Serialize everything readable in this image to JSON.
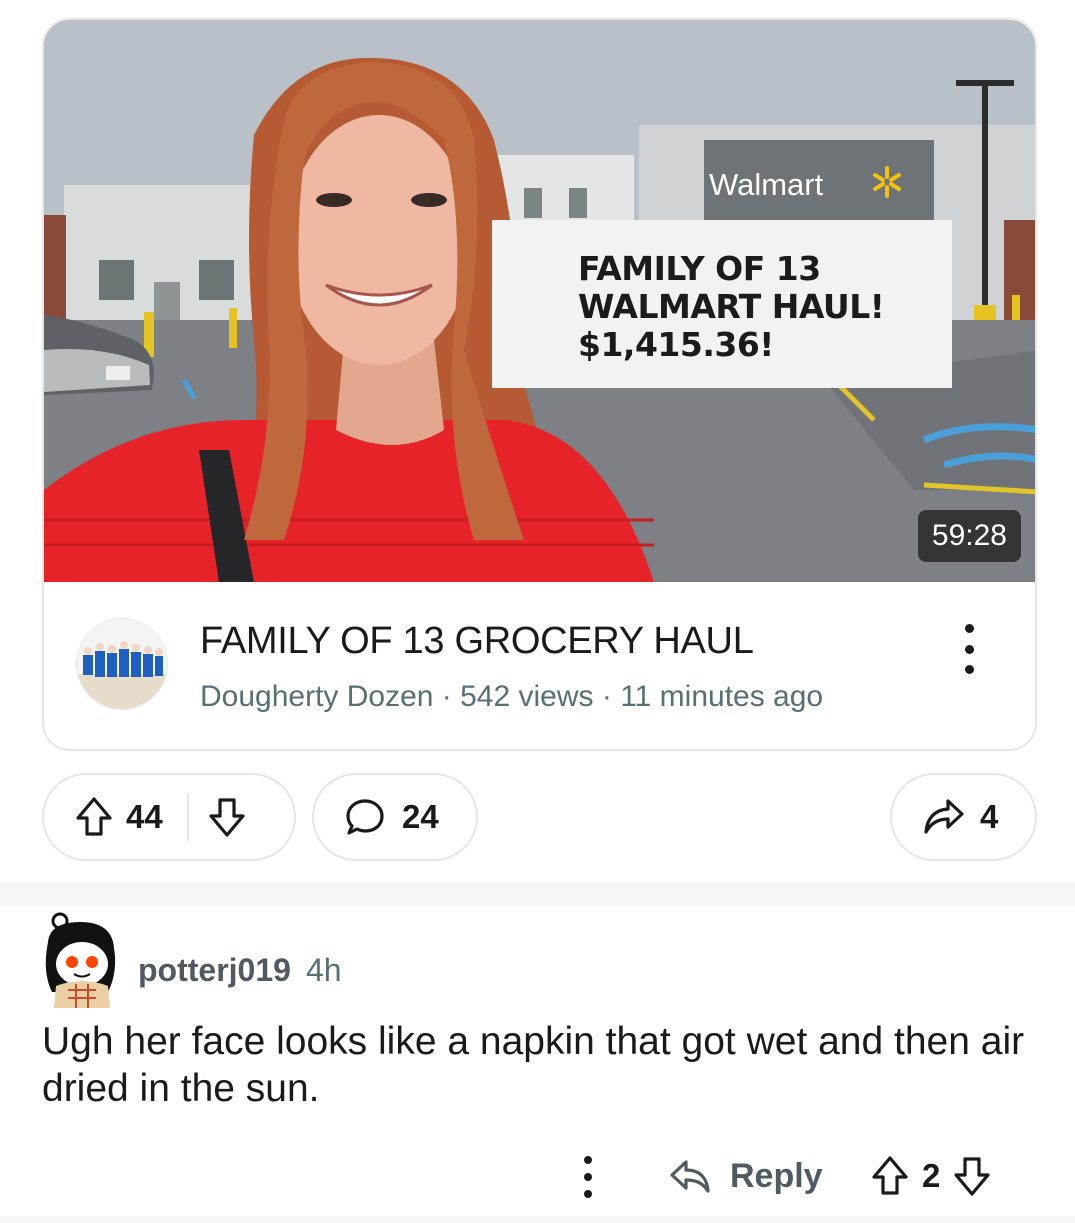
{
  "video": {
    "thumbnail_overlay": [
      "FAMILY OF 13",
      "WALMART HAUL!",
      "$1,415.36!"
    ],
    "store_sign": "Walmart",
    "duration": "59:28",
    "title": "FAMILY OF 13 GROCERY HAUL",
    "subtitle": "Dougherty Dozen · 542 views · 11 minutes ago"
  },
  "post_actions": {
    "upvotes": "44",
    "comments": "24",
    "shares": "4"
  },
  "comment": {
    "username": "potterj019",
    "age": "4h",
    "body": "Ugh her face looks like a napkin that got wet and then air dried in the sun.",
    "reply_label": "Reply",
    "score": "2"
  },
  "colors": {
    "text": "#1a1a1b",
    "muted": "#576f76",
    "border": "#e4e6e8",
    "shirt_red": "#e52329"
  },
  "icons": [
    "upvote-icon",
    "downvote-icon",
    "comment-icon",
    "share-icon",
    "more-icon",
    "reply-icon"
  ]
}
